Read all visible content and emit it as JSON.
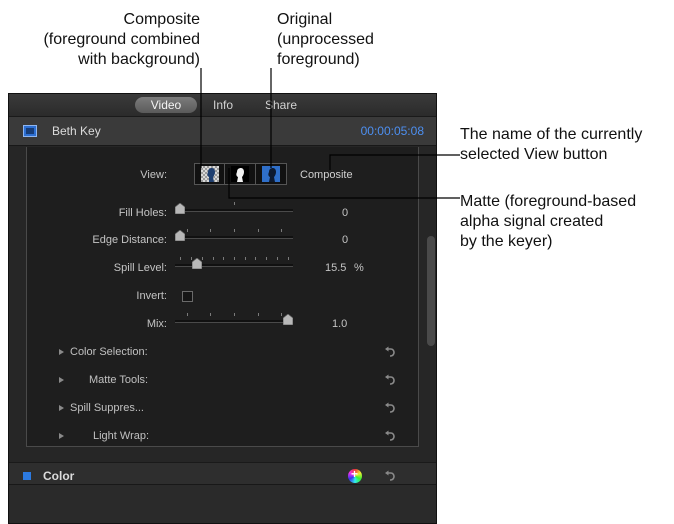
{
  "callouts": {
    "composite": "Composite\n(foreground combined\nwith background)",
    "original": "Original\n(unprocessed\nforeground)",
    "view_name": "The name of the currently\nselected View button",
    "matte": "Matte (foreground-based\nalpha signal created\nby the keyer)"
  },
  "tabs": {
    "video": "Video",
    "info": "Info",
    "share": "Share"
  },
  "clip": {
    "name": "Beth Key",
    "timecode": "00:00:05:08",
    "icon": "film-icon"
  },
  "keyer": {
    "view_label": "View:",
    "view_selected_name": "Composite",
    "view_buttons": [
      "composite-view",
      "matte-view",
      "original-view"
    ],
    "params": {
      "fill_holes": {
        "label": "Fill Holes:",
        "value": "0",
        "level": 0.0
      },
      "edge_distance": {
        "label": "Edge Distance:",
        "value": "0",
        "level": 0.0
      },
      "spill_level": {
        "label": "Spill Level:",
        "value": "15.5",
        "unit": "%",
        "level": 0.155
      },
      "invert": {
        "label": "Invert:",
        "checked": false
      },
      "mix": {
        "label": "Mix:",
        "value": "1.0",
        "level": 1.0
      }
    },
    "groups": [
      {
        "label": "Color Selection:"
      },
      {
        "label": "Matte Tools:"
      },
      {
        "label": "Spill Suppres..."
      },
      {
        "label": "Light Wrap:"
      }
    ]
  },
  "color_section": {
    "label": "Color",
    "swatch": "#2c7ae0"
  },
  "colors": {
    "accent_blue": "#4d8ff0",
    "panel_bg": "#262626"
  }
}
